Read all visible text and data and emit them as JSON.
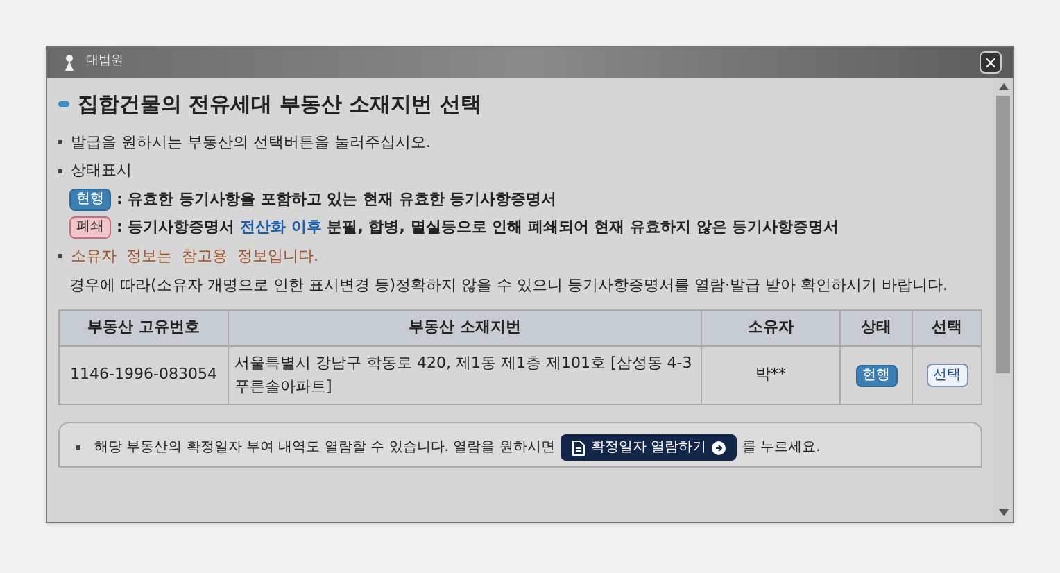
{
  "window": {
    "app_label": "대법원",
    "close": "×"
  },
  "heading": "집합건물의 전유세대 부동산 소재지번 선택",
  "intro": "발급을 원하시는 부동산의 선택버튼을 눌러주십시오.",
  "status_section": {
    "label": "상태표시",
    "legend": [
      {
        "badge": "현행",
        "kind": "current",
        "parts": [
          ": 유효한 등기사항을 포함하고 있는 현재 유효한 등기사항증명서"
        ]
      },
      {
        "badge": "폐쇄",
        "kind": "closed",
        "parts": [
          ": 등기사항증명서 ",
          "전산화 이후",
          " 분필, 합병, 멸실등으로 인해 폐쇄되어 현재 유효하지 않은 등기사항증명서"
        ]
      }
    ]
  },
  "owner_notice": {
    "title": "소유자  정보는  참고용  정보입니다.",
    "detail": "경우에 따라(소유자 개명으로 인한 표시변경 등)정확하지 않을 수 있으니 등기사항증명서를 열람·발급 받아 확인하시기 바랍니다."
  },
  "table": {
    "columns": [
      "부동산 고유번호",
      "부동산 소재지번",
      "소유자",
      "상태",
      "선택"
    ],
    "rows": [
      {
        "id": "1146-1996-083054",
        "address": "서울특별시 강남구 학동로 420, 제1동 제1층 제101호 [삼성동 4-3 푸른솔아파트]",
        "owner": "박**",
        "status": {
          "label": "현행",
          "kind": "current"
        },
        "select": "선택"
      }
    ]
  },
  "footer": {
    "before": "해당 부동산의 확정일자 부여 내역도 열람할 수 있습니다. 열람을 원하시면",
    "button": "확정일자 열람하기",
    "after": "를 누르세요."
  }
}
